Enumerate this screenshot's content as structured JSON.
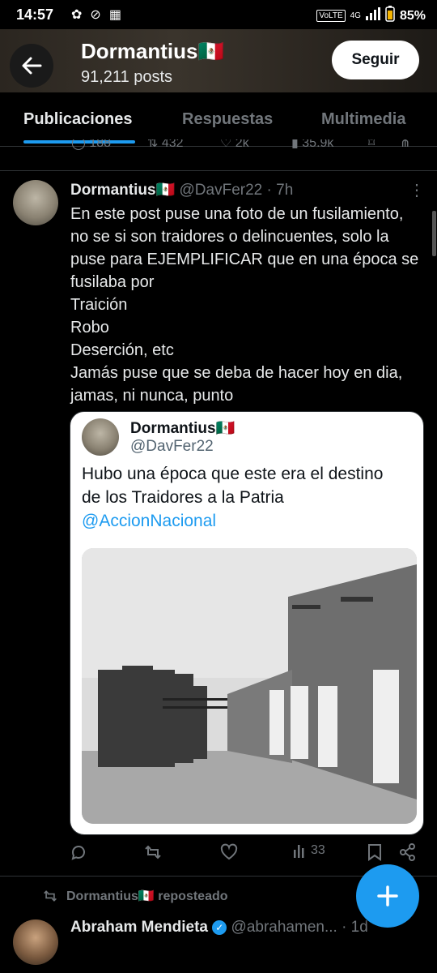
{
  "status": {
    "time": "14:57",
    "volte": "VoLTE",
    "signal": "4G",
    "battery": "85%"
  },
  "header": {
    "title": "Dormantius🇲🇽",
    "posts": "91,211 posts",
    "follow_label": "Seguir"
  },
  "tabs": [
    {
      "label": "Publicaciones"
    },
    {
      "label": "Respuestas"
    },
    {
      "label": "Multimedia"
    }
  ],
  "prev_actions": {
    "replies": "188",
    "reposts": "432",
    "likes": "2k",
    "views": "35.9k"
  },
  "tweet": {
    "name": "Dormantius🇲🇽",
    "handle": "@DavFer22",
    "time": "· 7h",
    "lines": [
      "En este post puse una foto de un fusilamiento,",
      "no se si son traidores o delincuentes, solo la",
      "puse para EJEMPLIFICAR que en una época se",
      "fusilaba por",
      "Traición",
      "Robo",
      "Deserción, etc",
      "Jamás puse que se deba de hacer hoy en dia,",
      "jamas, ni nunca, punto"
    ],
    "quote": {
      "name": "Dormantius🇲🇽",
      "handle": "@DavFer22",
      "line1": "Hubo una época que este era el destino",
      "line2": "de los Traidores a la Patria",
      "link": "@AccionNacional"
    },
    "actions": {
      "views": "33"
    }
  },
  "repost_line": "Dormantius🇲🇽 reposteado",
  "next_tweet": {
    "name": "Abraham Mendieta",
    "handle": "@abrahamen...",
    "time": "· 1d"
  }
}
